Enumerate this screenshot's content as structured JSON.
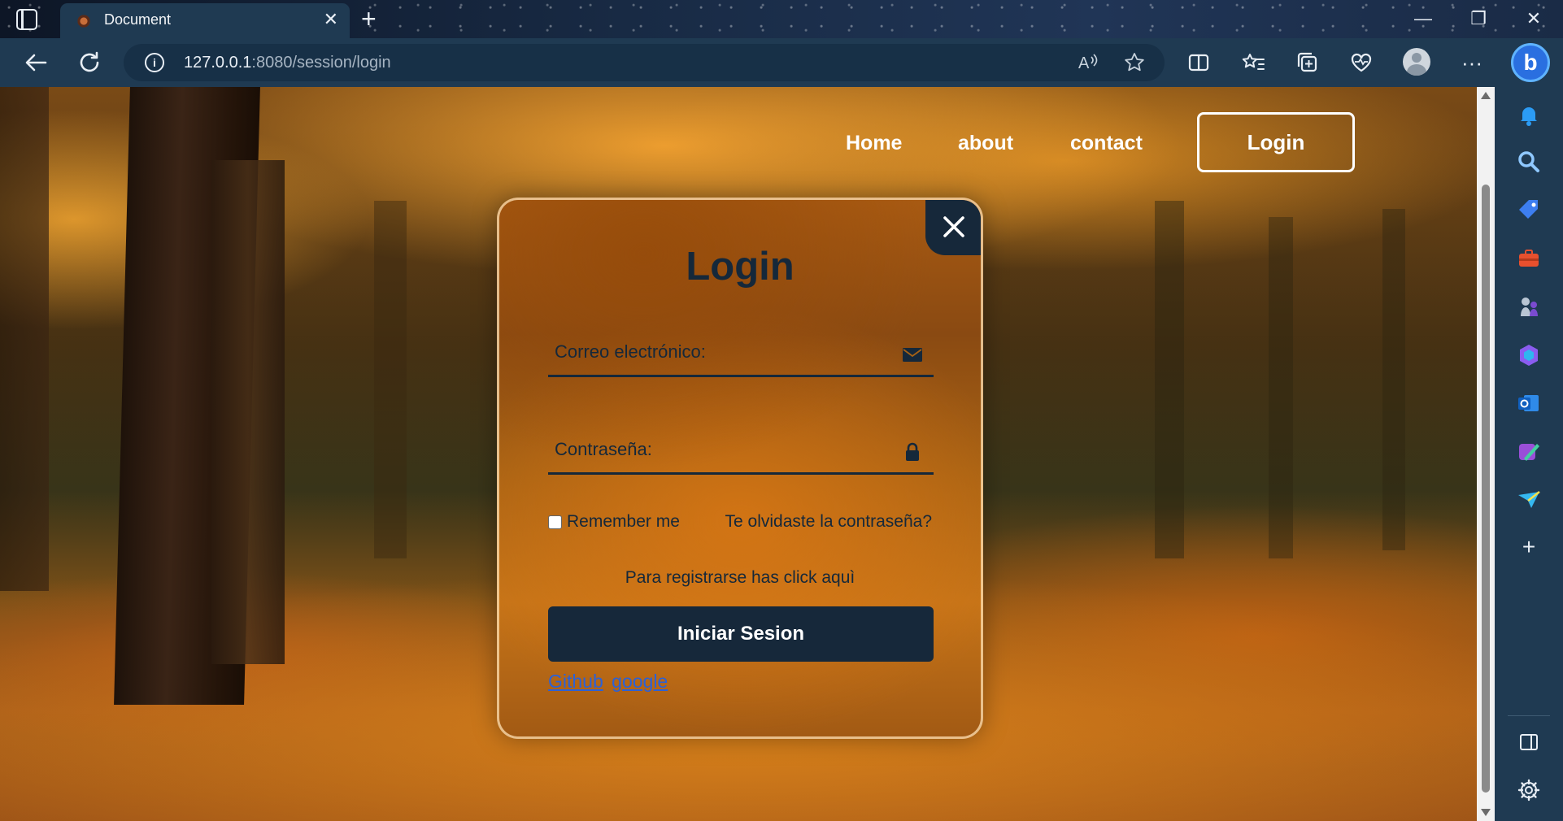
{
  "browser": {
    "tab_title": "Document",
    "tab_close": "✕",
    "new_tab": "+",
    "url_host": "127.0.0.1",
    "url_path": ":8080/session/login",
    "window_minimize": "—",
    "window_restore": "❐",
    "window_close": "✕",
    "more_menu": "···",
    "sidebar_add": "+"
  },
  "site_nav": {
    "home": "Home",
    "about": "about",
    "contact": "contact",
    "login": "Login"
  },
  "login_form": {
    "title": "Login",
    "email_label": "Correo electrónico:",
    "password_label": "Contraseña:",
    "remember_label": "Remember me",
    "forgot_link": "Te olvidaste la contraseña?",
    "register_text": "Para registrarse has click aquì",
    "submit_label": "Iniciar Sesion",
    "github_link": "Github",
    "google_link": "google"
  },
  "colors": {
    "chrome_bg": "#1f3a52",
    "form_text": "#15283a",
    "submit_bg": "#16283a",
    "link_blue": "#2b61d8"
  }
}
